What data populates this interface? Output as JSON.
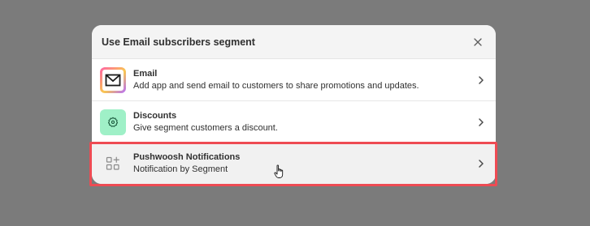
{
  "modal": {
    "title": "Use Email subscribers segment"
  },
  "items": [
    {
      "title": "Email",
      "description": "Add app and send email to customers to share promotions and updates.",
      "icon": "mail-icon"
    },
    {
      "title": "Discounts",
      "description": "Give segment customers a discount.",
      "icon": "discount-icon"
    },
    {
      "title": "Pushwoosh Notifications",
      "description": "Notification by Segment",
      "icon": "apps-add-icon"
    }
  ],
  "colors": {
    "backdrop": "#7b7b7b",
    "highlight": "#ee4b53",
    "discount_icon_bg": "#9ff0c7"
  }
}
